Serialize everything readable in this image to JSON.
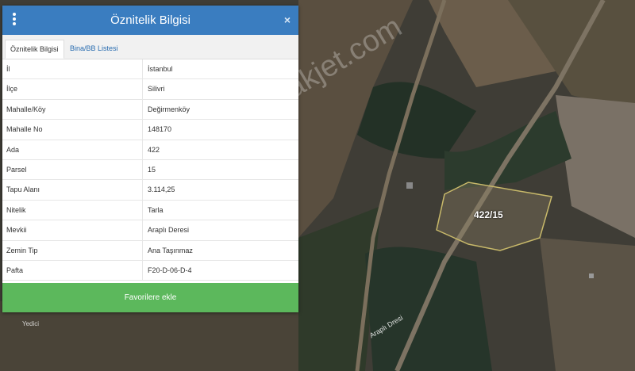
{
  "panel": {
    "title": "Öznitelik Bilgisi",
    "close_label": "×",
    "tabs": [
      {
        "label": "Öznitelik Bilgisi",
        "active": true
      },
      {
        "label": "Bina/BB Listesi",
        "active": false
      }
    ],
    "rows": [
      {
        "key": "İl",
        "value": "İstanbul"
      },
      {
        "key": "İlçe",
        "value": "Silivri"
      },
      {
        "key": "Mahalle/Köy",
        "value": "Değirmenköy"
      },
      {
        "key": "Mahalle No",
        "value": "148170"
      },
      {
        "key": "Ada",
        "value": "422"
      },
      {
        "key": "Parsel",
        "value": "15"
      },
      {
        "key": "Tapu Alanı",
        "value": "3.114,25"
      },
      {
        "key": "Nitelik",
        "value": "Tarla"
      },
      {
        "key": "Mevkii",
        "value": "Araplı Deresi"
      },
      {
        "key": "Zemin Tip",
        "value": "Ana Taşınmaz"
      },
      {
        "key": "Pafta",
        "value": "F20-D-06-D-4"
      }
    ],
    "favorite_button": "Favorilere ekle"
  },
  "map": {
    "parcel_label": "422/15",
    "stream_label": "Araplı Dresi",
    "place_label": "Yedici",
    "watermark": "emlakjet.com"
  },
  "colors": {
    "header": "#3a7dc0",
    "button": "#5cb85c",
    "parcel_outline": "#c8b96a"
  }
}
